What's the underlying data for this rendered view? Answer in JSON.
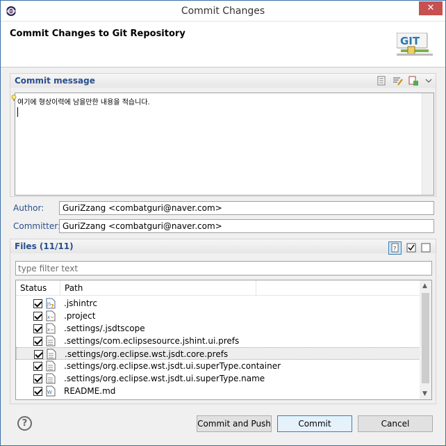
{
  "window": {
    "title": "Commit Changes",
    "close_glyph": "✕"
  },
  "header": {
    "title": "Commit Changes to Git Repository",
    "logo_text": "GIT"
  },
  "commit_message": {
    "section_title": "Commit message",
    "text": "여기에 형상이력에 남을만한 내용을 적습니다."
  },
  "author": {
    "label": "Author:",
    "value": "GuriZzang <combatguri@naver.com>"
  },
  "committer": {
    "label": "Committer:",
    "value": "GuriZzang <combatguri@naver.com>"
  },
  "files": {
    "section_title": "Files (11/11)",
    "filter_placeholder": "type filter text",
    "columns": {
      "status": "Status",
      "path": "Path"
    },
    "rows": [
      {
        "path": ".jshintrc",
        "icon": "untracked-file-icon"
      },
      {
        "path": ".project",
        "icon": "xml-file-icon"
      },
      {
        "path": ".settings/.jsdtscope",
        "icon": "xml-file-icon"
      },
      {
        "path": ".settings/com.eclipsesource.jshint.ui.prefs",
        "icon": "text-file-icon"
      },
      {
        "path": ".settings/org.eclipse.wst.jsdt.core.prefs",
        "icon": "text-file-icon"
      },
      {
        "path": ".settings/org.eclipse.wst.jsdt.ui.superType.container",
        "icon": "text-file-icon"
      },
      {
        "path": ".settings/org.eclipse.wst.jsdt.ui.superType.name",
        "icon": "text-file-icon"
      },
      {
        "path": "README.md",
        "icon": "markdown-file-icon"
      }
    ]
  },
  "buttons": {
    "help": "?",
    "commit_and_push": "Commit and Push",
    "commit": "Commit",
    "cancel": "Cancel"
  },
  "colors": {
    "section_title": "#2a4e8c",
    "close_button": "#c75050"
  }
}
